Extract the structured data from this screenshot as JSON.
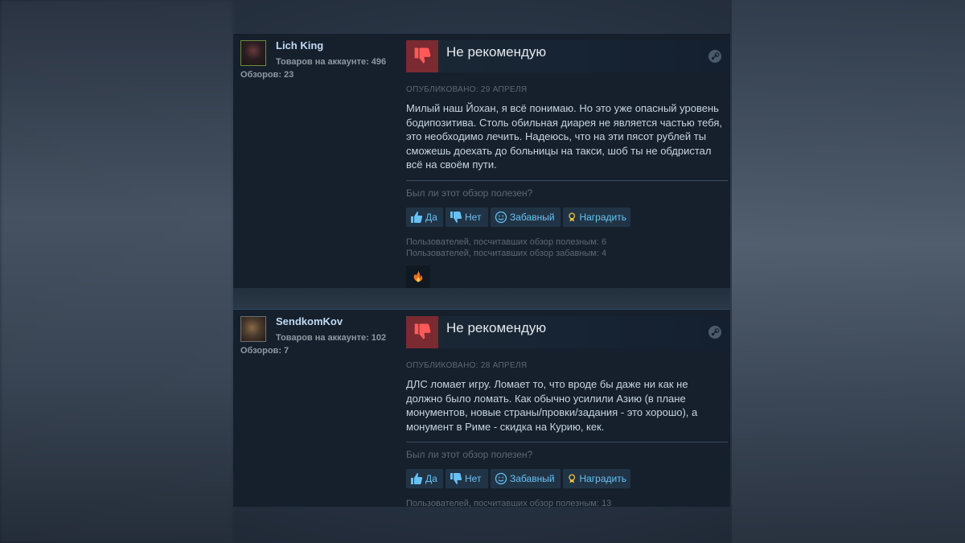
{
  "reviews": [
    {
      "author": {
        "name": "Lich King",
        "products": "Товаров на аккаунте: 496",
        "reviews": "Обзоров: 23"
      },
      "verdict": "Не рекомендую",
      "posted": "Опубликовано: 29 апреля",
      "text": "Милый наш Йохан, я всё понимаю. Но это уже опасный уровень бодипозитива. Столь обильная диарея не является частью тебя, это необходимо лечить. Надеюсь, что на эти пясот рублей ты сможешь доехать до больницы на такси, шоб ты не обдристал всё на своём пути.",
      "helpful_question": "Был ли этот обзор полезен?",
      "buttons": {
        "yes": "Да",
        "no": "Нет",
        "funny": "Забавный",
        "award": "Наградить"
      },
      "stats": [
        "Пользователей, посчитавших обзор полезным: 6",
        "Пользователей, посчитавших обзор забавным: 4"
      ],
      "award_icon": "flame-award-icon"
    },
    {
      "author": {
        "name": "SendkomKov",
        "products": "Товаров на аккаунте: 102",
        "reviews": "Обзоров: 7"
      },
      "verdict": "Не рекомендую",
      "posted": "Опубликовано: 28 апреля",
      "text": "ДЛС ломает игру. Ломает то, что вроде бы даже ни как не должно было ломать. Как обычно усилили Азию (в плане монументов, новые страны/провки/задания - это хорошо), а монумент в Риме - скидка на Курию, кек.",
      "helpful_question": "Был ли этот обзор полезен?",
      "buttons": {
        "yes": "Да",
        "no": "Нет",
        "funny": "Забавный",
        "award": "Наградить"
      },
      "stats": [
        "Пользователей, посчитавших обзор полезным: 13"
      ]
    }
  ],
  "colors": {
    "panel": "#16202d",
    "thumb_down_bg": "#7a2a30",
    "link": "#67c1f5",
    "author_name": "#c1dbf4",
    "muted": "#5c6873",
    "text": "#c6d4df"
  }
}
